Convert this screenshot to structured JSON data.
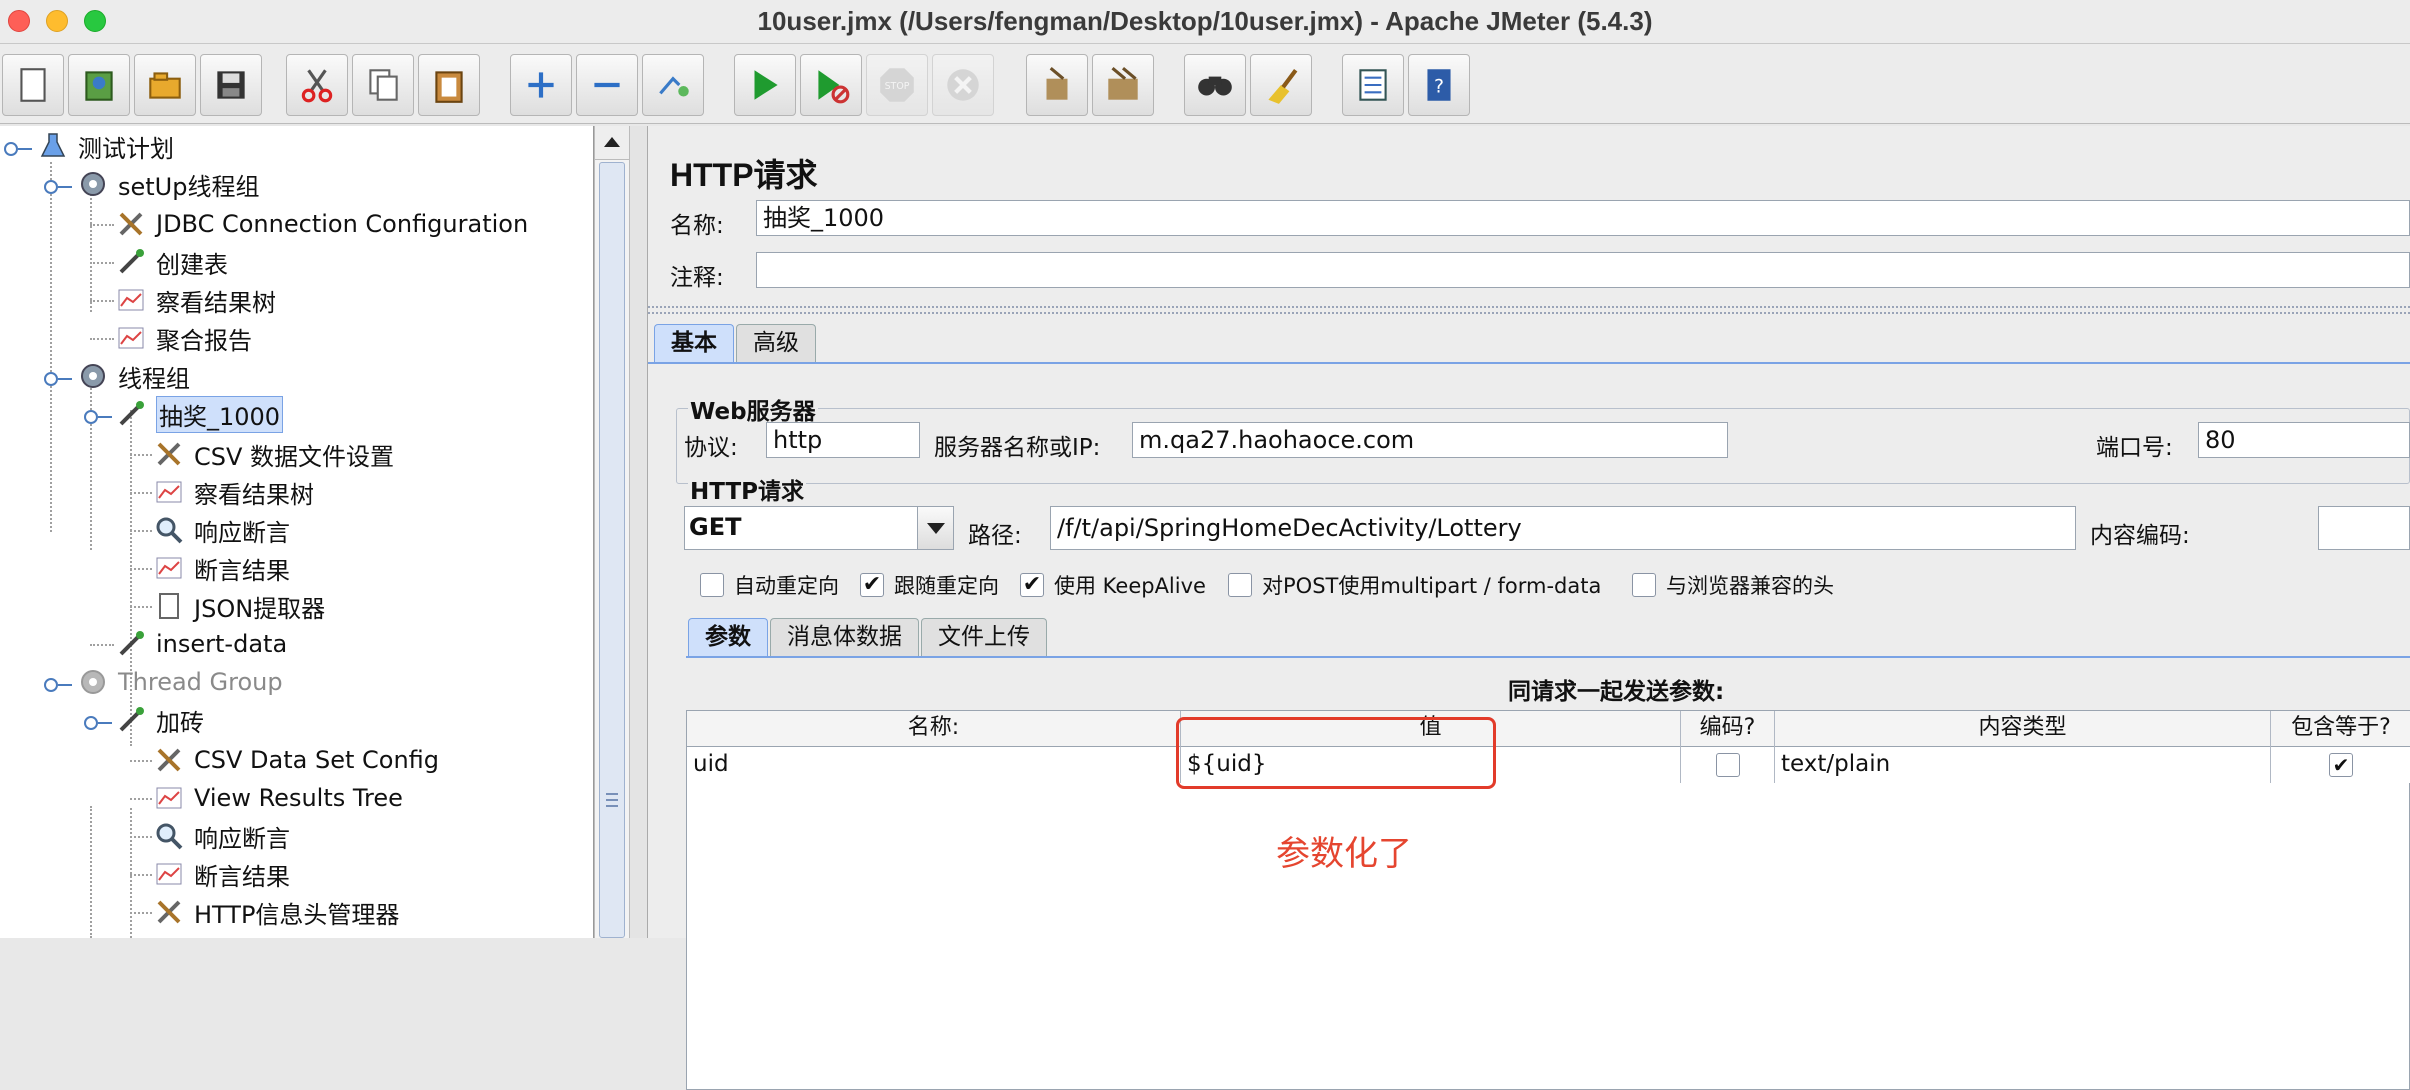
{
  "window": {
    "title": "10user.jmx (/Users/fengman/Desktop/10user.jmx) - Apache JMeter (5.4.3)"
  },
  "toolbar": {
    "buttons": [
      "new-icon",
      "templates-icon",
      "open-icon",
      "save-icon",
      "cut-icon",
      "copy-icon",
      "paste-icon",
      "expand-icon",
      "collapse-icon",
      "toggle-icon",
      "start-icon",
      "start-no-pauses-icon",
      "stop-icon",
      "shutdown-icon",
      "clear-icon",
      "clear-all-icon",
      "search-icon",
      "reset-search-icon",
      "function-helper-icon",
      "help-icon"
    ]
  },
  "tree": {
    "items": [
      {
        "label": "测试计划"
      },
      {
        "label": "setUp线程组"
      },
      {
        "label": "JDBC Connection Configuration"
      },
      {
        "label": "创建表"
      },
      {
        "label": "察看结果树"
      },
      {
        "label": "聚合报告"
      },
      {
        "label": "线程组"
      },
      {
        "label": "抽奖_1000"
      },
      {
        "label": "CSV 数据文件设置"
      },
      {
        "label": "察看结果树"
      },
      {
        "label": "响应断言"
      },
      {
        "label": "断言结果"
      },
      {
        "label": "JSON提取器"
      },
      {
        "label": "insert-data"
      },
      {
        "label": "Thread Group"
      },
      {
        "label": "加砖"
      },
      {
        "label": "CSV Data Set Config"
      },
      {
        "label": "View Results Tree"
      },
      {
        "label": "响应断言"
      },
      {
        "label": "断言结果"
      },
      {
        "label": "HTTP信息头管理器"
      }
    ]
  },
  "panel": {
    "title": "HTTP请求",
    "name_label": "名称:",
    "name_value": "抽奖_1000",
    "comment_label": "注释:",
    "comment_value": "",
    "tabs": {
      "basic": "基本",
      "advanced": "高级"
    },
    "web_server": {
      "title": "Web服务器",
      "protocol_label": "协议:",
      "protocol_value": "http",
      "server_label": "服务器名称或IP:",
      "server_value": "m.qa27.haohaoce.com",
      "port_label": "端口号:",
      "port_value": "80"
    },
    "http_request": {
      "title": "HTTP请求",
      "method": "GET",
      "path_label": "路径:",
      "path_value": "/f/t/api/SpringHomeDecActivity/Lottery",
      "encoding_label": "内容编码:",
      "encoding_value": ""
    },
    "options": [
      {
        "label": "自动重定向",
        "checked": false
      },
      {
        "label": "跟随重定向",
        "checked": true
      },
      {
        "label": "使用 KeepAlive",
        "checked": true
      },
      {
        "label": "对POST使用multipart / form-data",
        "checked": false
      },
      {
        "label": "与浏览器兼容的头",
        "checked": false
      }
    ],
    "subtabs": {
      "params": "参数",
      "body": "消息体数据",
      "files": "文件上传"
    },
    "params_caption": "同请求一起发送参数:",
    "table": {
      "headers": {
        "name": "名称:",
        "value": "值",
        "encode": "编码?",
        "content_type": "内容类型",
        "include_equals": "包含等于?"
      },
      "rows": [
        {
          "name": "uid",
          "value": "${uid}",
          "encode": "",
          "content_type": "text/plain",
          "include_equals": "✔"
        }
      ]
    },
    "annotation": "参数化了"
  },
  "colors": {
    "accent": "#7aa3e5",
    "annotation": "#e5452f"
  }
}
